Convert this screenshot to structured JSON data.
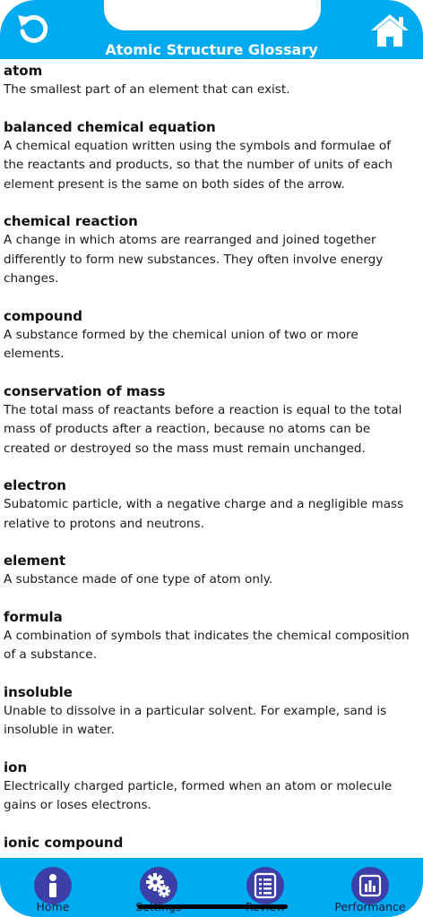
{
  "header": {
    "title": "Atomic Structure Glossary",
    "back_icon": "back-arrow-icon",
    "home_icon": "house-icon",
    "color": "#00aaf0"
  },
  "glossary": [
    {
      "term": "atom",
      "definition": "The smallest part of an element that can exist."
    },
    {
      "term": "balanced chemical equation",
      "definition": "A chemical equation written using the symbols and formulae of the reactants and products, so that the number of units of each element present is the same on both sides of the arrow."
    },
    {
      "term": "chemical reaction",
      "definition": "A change in which atoms are rearranged and joined together differently to form new substances. They often involve energy changes."
    },
    {
      "term": "compound",
      "definition": "A substance formed by the chemical union of two or more elements."
    },
    {
      "term": "conservation of mass",
      "definition": "The total mass of reactants before a reaction is equal to the total mass of products after a reaction, because no atoms can be created or destroyed so the mass must remain unchanged."
    },
    {
      "term": "electron",
      "definition": "Subatomic particle, with a negative charge and a negligible mass relative to protons and neutrons."
    },
    {
      "term": "element",
      "definition": "A substance made of one type of atom only."
    },
    {
      "term": "formula",
      "definition": "A combination of symbols that indicates the chemical composition of a substance."
    },
    {
      "term": "insoluble",
      "definition": "Unable to dissolve in a particular solvent. For example, sand is insoluble in water."
    },
    {
      "term": "ion",
      "definition": "Electrically charged particle, formed when an atom or molecule gains or loses electrons."
    },
    {
      "term": "ionic compound",
      "definition": ""
    }
  ],
  "tabbar": {
    "tabs": [
      {
        "label": "Home",
        "icon": "info-icon"
      },
      {
        "label": "Settings",
        "icon": "gears-icon"
      },
      {
        "label": "Review",
        "icon": "checklist-icon"
      },
      {
        "label": "Performance",
        "icon": "bar-chart-icon"
      }
    ],
    "color": "#00aaf0",
    "icon_bg": "#3d3fa8"
  }
}
